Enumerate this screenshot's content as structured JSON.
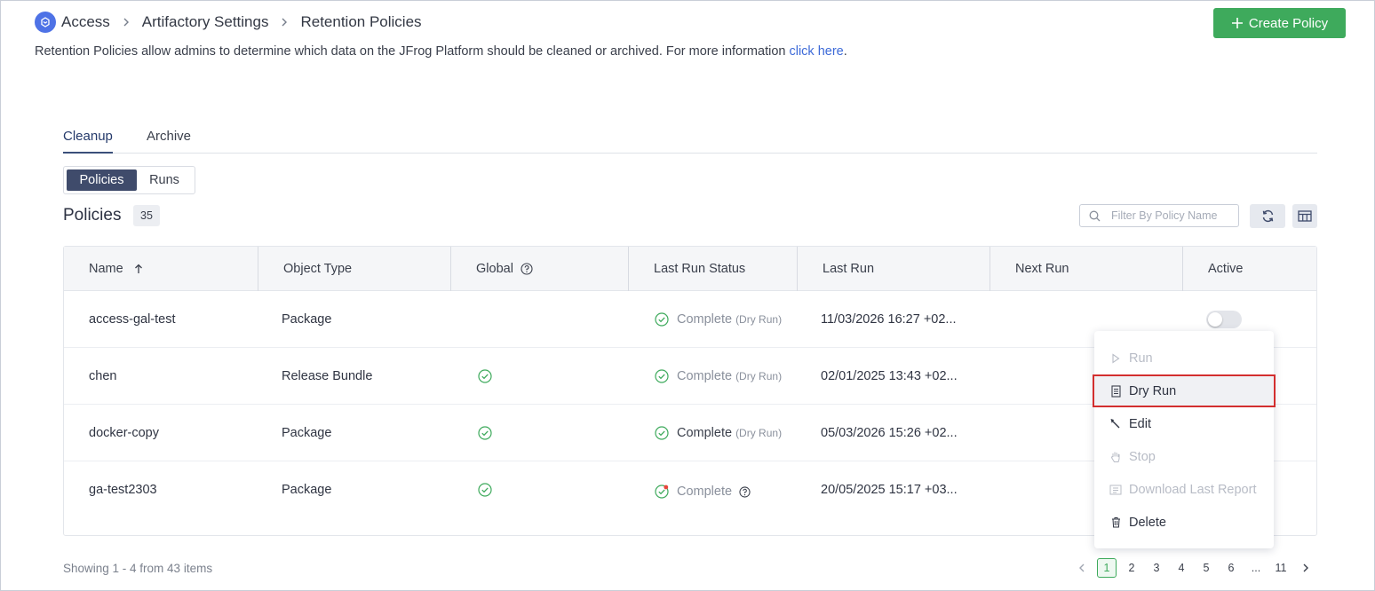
{
  "breadcrumb": {
    "items": [
      "Access",
      "Artifactory Settings",
      "Retention Policies"
    ]
  },
  "header": {
    "create_label": "Create Policy",
    "intro_text": "Retention Policies allow admins to determine which data on the JFrog Platform should be cleaned or archived. For more information ",
    "intro_link": "click here",
    "intro_end": "."
  },
  "tabs": [
    {
      "label": "Cleanup",
      "active": true
    },
    {
      "label": "Archive",
      "active": false
    }
  ],
  "segment": {
    "policies_label": "Policies",
    "runs_label": "Runs"
  },
  "section": {
    "title": "Policies",
    "count": "35",
    "filter_placeholder": "Filter By Policy Name"
  },
  "table": {
    "columns": [
      "Name",
      "Object Type",
      "Global",
      "Last Run Status",
      "Last Run",
      "Next Run",
      "Active"
    ],
    "rows": [
      {
        "name": "access-gal-test",
        "type": "Package",
        "global": false,
        "status": "Complete",
        "status_note": "(Dry Run)",
        "status_icon": "check-circle-icon",
        "last_run": "11/03/2026 16:27 +02...",
        "next_run": "",
        "active": false
      },
      {
        "name": "chen",
        "type": "Release Bundle",
        "global": true,
        "status": "Complete",
        "status_note": "(Dry Run)",
        "status_icon": "check-circle-icon",
        "last_run": "02/01/2025 13:43 +02...",
        "next_run": "",
        "active": false
      },
      {
        "name": "docker-copy",
        "type": "Package",
        "global": true,
        "status": "Complete",
        "status_note": "(Dry Run)",
        "status_icon": "check-circle-icon",
        "last_run": "05/03/2026 15:26 +02...",
        "next_run": "",
        "active": false
      },
      {
        "name": "ga-test2303",
        "type": "Package",
        "global": true,
        "status": "Complete",
        "status_note": "",
        "status_icon": "check-circle-warning-icon",
        "last_run": "20/05/2025 15:17 +03...",
        "next_run": "",
        "active": false
      }
    ]
  },
  "context_menu": {
    "items": [
      {
        "label": "Run",
        "icon": "play-icon",
        "disabled": true
      },
      {
        "label": "Dry Run",
        "icon": "document-icon",
        "disabled": false,
        "highlighted": true
      },
      {
        "label": "Edit",
        "icon": "pencil-icon",
        "disabled": false
      },
      {
        "label": "Stop",
        "icon": "hand-icon",
        "disabled": true
      },
      {
        "label": "Download Last Report",
        "icon": "download-report-icon",
        "disabled": true
      },
      {
        "label": "Delete",
        "icon": "trash-icon",
        "disabled": false
      }
    ]
  },
  "footer": {
    "showing": "Showing 1 - 4 from 43 items",
    "pages": [
      "1",
      "2",
      "3",
      "4",
      "5",
      "6",
      "...",
      "11"
    ],
    "current_page": "1"
  },
  "colors": {
    "primary_green": "#3eaa5c",
    "link_blue": "#3d6ad8",
    "selected_segment": "#3f4b6b",
    "highlight_border": "#d32f2f"
  }
}
